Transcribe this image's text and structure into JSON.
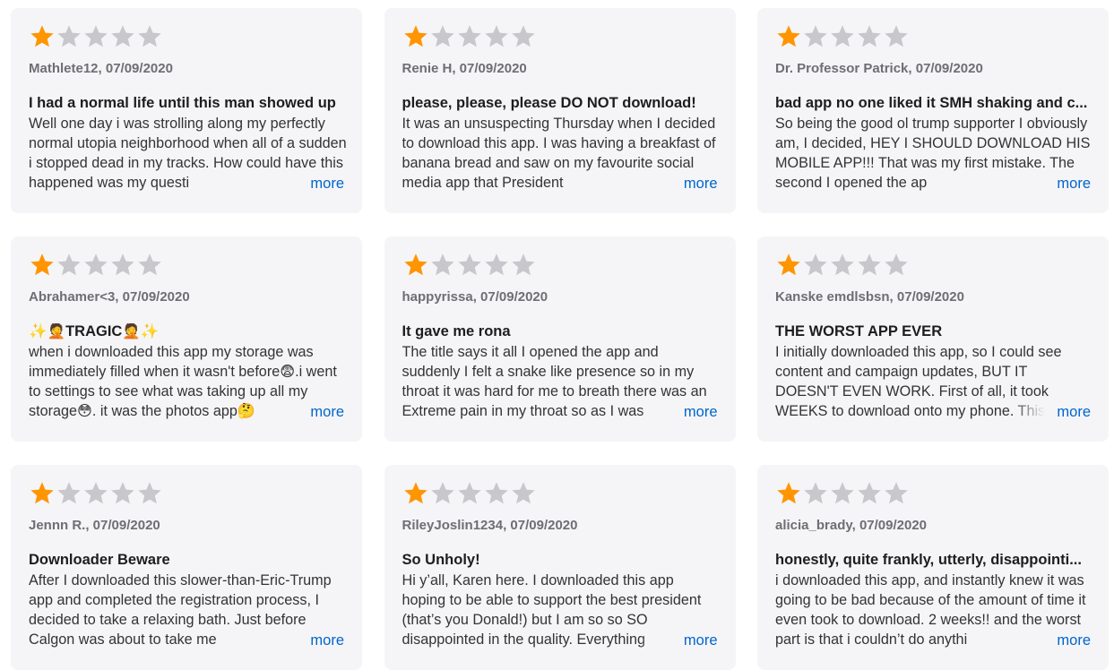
{
  "colors": {
    "star_filled": "#ff9500",
    "star_empty": "#c7c7cc",
    "card_bg": "#f5f5f7",
    "link": "#0066cc"
  },
  "more_label": "more",
  "reviews": [
    {
      "rating": 1,
      "author_date": "Mathlete12, 07/09/2020",
      "title": "I had a normal life until this man showed up",
      "body": "Well one day i was strolling along my perfectly normal utopia neighborhood when all of a sudden i stopped dead in my tracks. How could have this happened was my questi"
    },
    {
      "rating": 1,
      "author_date": "Renie H, 07/09/2020",
      "title": "please, please, please DO NOT download!",
      "body": "It was an unsuspecting Thursday when I decided to download this app. I was having a breakfast of banana bread and saw on my favourite social media app that President"
    },
    {
      "rating": 1,
      "author_date": "Dr. Professor Patrick, 07/09/2020",
      "title": "bad app no one liked it SMH shaking and c...",
      "body": "So being the good ol trump supporter I obviously am, I decided, HEY I SHOULD DOWNLOAD HIS MOBILE APP!!! That was my first mistake. The second I opened the ap"
    },
    {
      "rating": 1,
      "author_date": "Abrahamer<3, 07/09/2020",
      "title": "✨🤦TRAGIC🤦✨",
      "body": "when i downloaded this app my storage was immediately filled when it wasn't before😨.i went to settings to see what was taking up all my storage😳. it was the photos app🤔"
    },
    {
      "rating": 1,
      "author_date": "happyrissa, 07/09/2020",
      "title": "It gave me rona",
      "body": "The title says it all I opened the app and suddenly I felt a snake like presence so in my throat it was hard for me to breath there was an Extreme pain in my throat so as I was"
    },
    {
      "rating": 1,
      "author_date": "Kanske emdlsbsn, 07/09/2020",
      "title": "THE WORST APP EVER",
      "body": "I initially downloaded this app, so I could see content and campaign updates, BUT IT DOESN'T EVEN WORK. First of all, it took WEEKS to download onto my phone. This"
    },
    {
      "rating": 1,
      "author_date": "Jennn R., 07/09/2020",
      "title": "Downloader Beware",
      "body": "After I downloaded this slower-than-Eric-Trump app and completed the registration process, I decided to take a relaxing bath. Just before Calgon was about to take me"
    },
    {
      "rating": 1,
      "author_date": "RileyJoslin1234, 07/09/2020",
      "title": "So Unholy!",
      "body": "Hi y’all, Karen here. I downloaded this app hoping to be able to support the best president (that’s you Donald!) but I am so so SO disappointed in the quality. Everything"
    },
    {
      "rating": 1,
      "author_date": "alicia_brady, 07/09/2020",
      "title": "honestly, quite frankly, utterly, disappointi...",
      "body": "i downloaded this app, and instantly knew it was going to be bad because of the amount of time it even took to download. 2 weeks!! and the worst part is that i couldn’t do anythi"
    }
  ]
}
